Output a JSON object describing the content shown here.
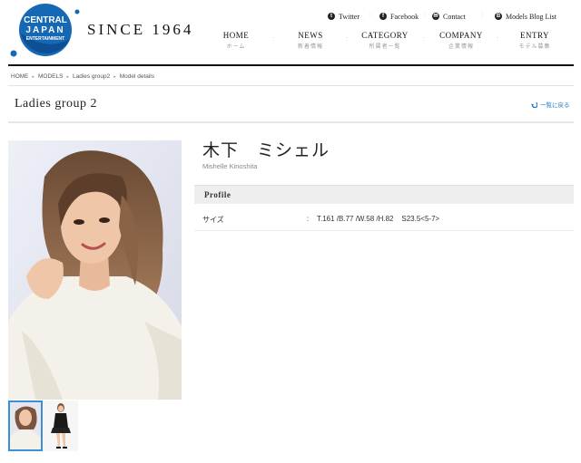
{
  "logo": {
    "line1": "CENTRAL",
    "line2": "JAPAN",
    "line3": "ENTERTAINMENT",
    "colors": {
      "primary": "#1468b4",
      "dark": "#0d4f92"
    }
  },
  "header": {
    "since": "SINCE 1964"
  },
  "social": [
    {
      "label": "Twitter",
      "icon": "twitter-icon",
      "glyph": "t"
    },
    {
      "label": "Facebook",
      "icon": "facebook-icon",
      "glyph": "f"
    },
    {
      "label": "Contact",
      "icon": "mail-icon",
      "glyph": "✉"
    },
    {
      "label": "Models Blog List",
      "icon": "blog-icon",
      "glyph": "B"
    }
  ],
  "nav": [
    {
      "en": "HOME",
      "jp": "ホーム"
    },
    {
      "en": "NEWS",
      "jp": "新着情報"
    },
    {
      "en": "CATEGORY",
      "jp": "所属者一覧"
    },
    {
      "en": "COMPANY",
      "jp": "企業情報"
    },
    {
      "en": "ENTRY",
      "jp": "モデル募集"
    }
  ],
  "breadcrumb": [
    "HOME",
    "MODELS",
    "Ladies group2",
    "Model details"
  ],
  "page": {
    "title": "Ladies group 2",
    "back_label": "一覧に戻る"
  },
  "model": {
    "name_jp": "木下　ミシェル",
    "name_en": "Mishelle Kinoshita",
    "profile_heading": "Profile",
    "rows": [
      {
        "label": "サイズ",
        "colon": ":",
        "value": "T.161 /B.77 /W.58 /H.82    S23.5<5-7>"
      }
    ]
  },
  "colors": {
    "accent": "#3a8fd6",
    "link": "#1a73c0",
    "rule": "#111111"
  }
}
